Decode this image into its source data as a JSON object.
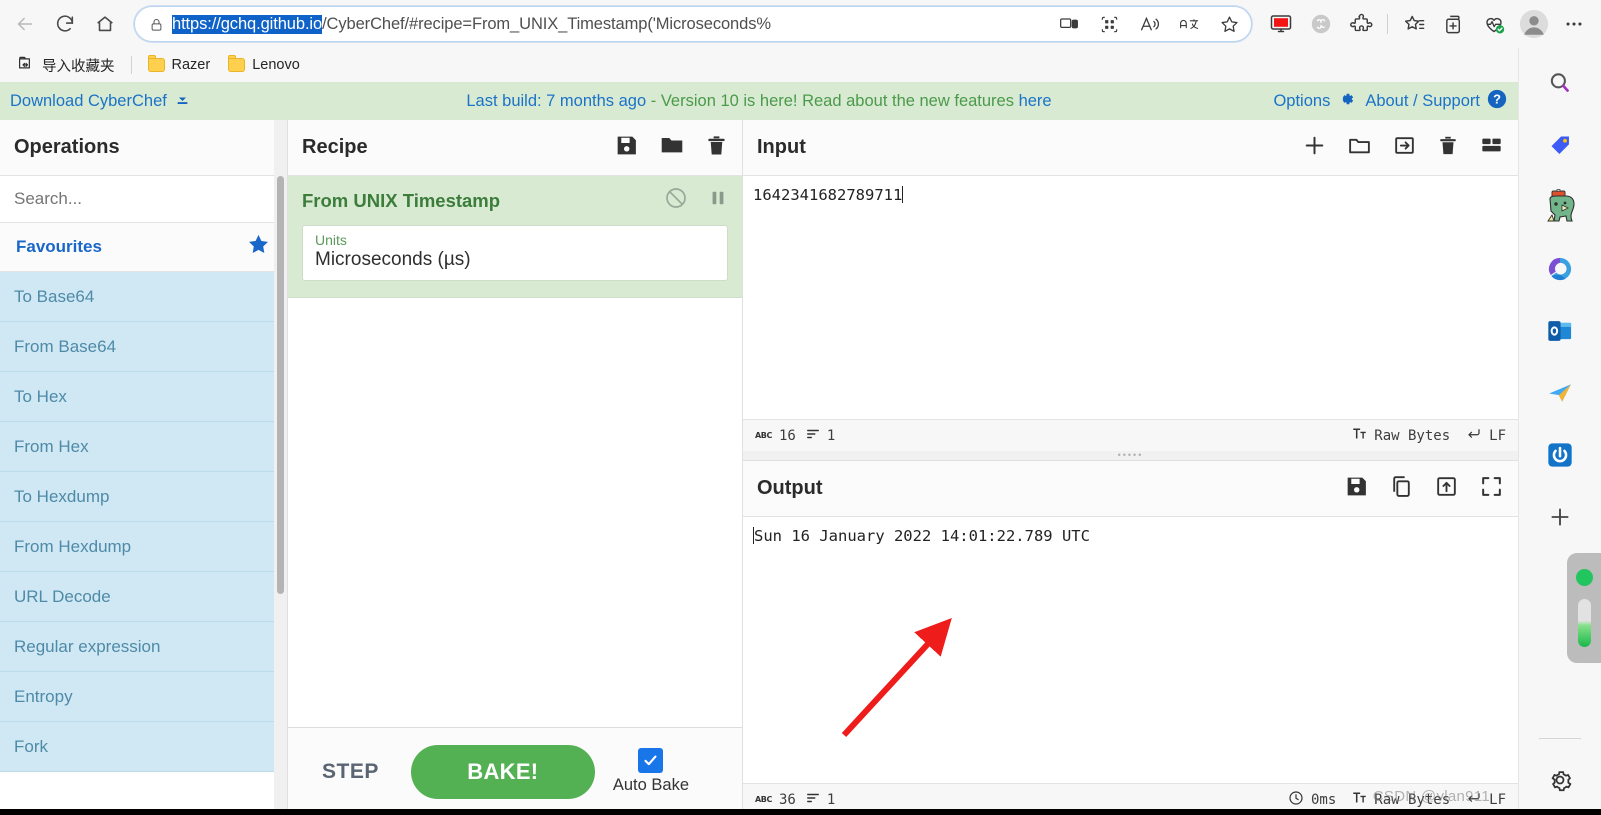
{
  "browser": {
    "nav": {
      "back_label": "Back",
      "refresh_label": "Refresh",
      "home_label": "Home"
    },
    "omnibox": {
      "url_host": "https://gchq.github.io",
      "url_rest": "/CyberChef/#recipe=From_UNIX_Timestamp('Microseconds%",
      "lock_icon": "lock-icon",
      "split_screen_icon": "split-screen-icon",
      "qr_icon": "qr-code-icon",
      "read_aloud_icon": "read-aloud-icon",
      "translate_icon": "translate-icon",
      "favourite_icon": "favourite-star-icon"
    },
    "toolbar_icons": [
      "screen-capture-icon",
      "browser-essentials-icon",
      "extensions-icon",
      "collections-star-icon",
      "add-to-collection-icon",
      "performance-heart-icon",
      "profile-avatar-icon",
      "settings-more-icon"
    ],
    "bookmarks": {
      "import_label": "导入收藏夹",
      "items": [
        {
          "label": "Razer",
          "icon": "folder-icon"
        },
        {
          "label": "Lenovo",
          "icon": "folder-icon"
        }
      ]
    }
  },
  "banner": {
    "download_label": "Download CyberChef",
    "download_icon": "download-arrow-icon",
    "build_link": "Last build: 7 months ago",
    "build_text": " - Version 10 is here! Read about the new features ",
    "build_link2": "here",
    "options_label": "Options",
    "options_icon": "gear-icon",
    "about_label": "About / Support",
    "about_icon": "question-circle-icon"
  },
  "operations": {
    "title": "Operations",
    "search": {
      "placeholder": "Search...",
      "value": ""
    },
    "favourites": {
      "label": "Favourites",
      "icon": "star-icon"
    },
    "items": [
      {
        "label": "To Base64"
      },
      {
        "label": "From Base64"
      },
      {
        "label": "To Hex"
      },
      {
        "label": "From Hex"
      },
      {
        "label": "To Hexdump"
      },
      {
        "label": "From Hexdump"
      },
      {
        "label": "URL Decode"
      },
      {
        "label": "Regular expression"
      },
      {
        "label": "Entropy"
      },
      {
        "label": "Fork"
      }
    ]
  },
  "recipe": {
    "title": "Recipe",
    "icons": [
      "save-icon",
      "load-folder-icon",
      "clear-trash-icon"
    ],
    "operation": {
      "name": "From UNIX Timestamp",
      "disable_icon": "disable-icon",
      "breakpoint_icon": "pause-breakpoint-icon",
      "arg_label": "Units",
      "arg_value": "Microseconds (µs)"
    },
    "controls": {
      "step_label": "STEP",
      "bake_label": "BAKE!",
      "auto_bake_label": "Auto Bake",
      "auto_bake_checked": true,
      "bake_color": "#53b153"
    }
  },
  "input": {
    "title": "Input",
    "icons": [
      "add-tab-icon",
      "open-folder-icon",
      "open-input-icon",
      "clear-trash-icon",
      "tab-layout-icon"
    ],
    "value": "1642341682789711",
    "status": {
      "length_icon": "character-count-icon",
      "length": "16",
      "lines_icon": "line-count-icon",
      "lines": "1",
      "encoding_icon": "font-icon",
      "encoding": "Raw Bytes",
      "eol_icon": "line-break-icon",
      "eol": "LF"
    }
  },
  "output": {
    "title": "Output",
    "icons": [
      "save-icon",
      "copy-icon",
      "replace-input-icon",
      "maximise-icon"
    ],
    "value": "Sun 16 January 2022 14:01:22.789 UTC",
    "status": {
      "length_icon": "character-count-icon",
      "length": "36",
      "lines_icon": "line-count-icon",
      "lines": "1",
      "time_icon": "clock-icon",
      "time": "0ms",
      "encoding_icon": "font-icon",
      "encoding": "Raw Bytes",
      "eol_icon": "line-break-icon",
      "eol": "LF"
    }
  },
  "annotation": {
    "arrow_color": "#ef1c1c",
    "description": "red-arrow-pointing-to-output-time"
  },
  "watermark": {
    "text": "CSDN @vlan911"
  },
  "edge_sidebar": {
    "icons": [
      "search-icon",
      "shopping-tag-icon",
      "game-dino-icon",
      "microsoft-365-icon",
      "outlook-icon",
      "telegram-send-icon",
      "power-toggle-icon",
      "add-sidebar-app-icon"
    ],
    "settings_icon": "settings-gear-icon"
  }
}
